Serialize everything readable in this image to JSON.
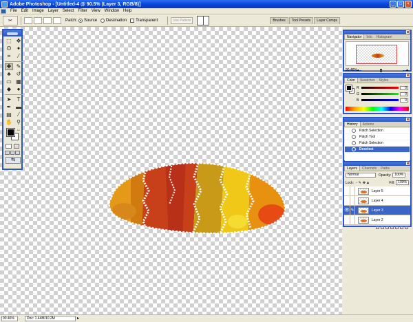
{
  "window": {
    "title": "Adobe Photoshop - [Untitled-4 @ 90.5% (Layer 3, RGB/8)]"
  },
  "menu": [
    "File",
    "Edit",
    "Image",
    "Layer",
    "Select",
    "Filter",
    "View",
    "Window",
    "Help"
  ],
  "options": {
    "patch_label": "Patch:",
    "source_label": "Source",
    "source_selected": true,
    "destination_label": "Destination",
    "transparent_label": "Transparent",
    "use_pattern_label": "Use Pattern"
  },
  "palette_well": [
    "Brushes",
    "Tool Presets",
    "Layer Comps"
  ],
  "navigator": {
    "tabs": [
      "Navigator",
      "Info",
      "Histogram"
    ],
    "zoom": "90.46%"
  },
  "color_panel": {
    "tabs": [
      "Color",
      "Swatches",
      "Styles"
    ],
    "channels": [
      {
        "label": "R",
        "value": "0"
      },
      {
        "label": "G",
        "value": "0"
      },
      {
        "label": "B",
        "value": "0"
      }
    ]
  },
  "history": {
    "tabs": [
      "History",
      "Actions"
    ],
    "items": [
      "Patch Selection",
      "Patch Tool",
      "Patch Selection",
      "Deselect"
    ],
    "selected_index": 3
  },
  "layers": {
    "tabs": [
      "Layers",
      "Channels",
      "Paths"
    ],
    "blend_mode": "Normal",
    "opacity_label": "Opacity:",
    "opacity": "100%",
    "lock_label": "Lock:",
    "fill_label": "Fill:",
    "fill": "100%",
    "items": [
      "Layer 5",
      "Layer 4",
      "Layer 3",
      "Layer 2"
    ],
    "selected_index": 2
  },
  "status": {
    "zoom": "90.46%",
    "doc": "Doc: 1.44M/10.2M"
  },
  "colors": {
    "title_bar": "#0a46d8",
    "panel_border": "#2a55c8",
    "selection": "#3a64c8",
    "foreground": "#000000",
    "background": "#ffffff"
  }
}
